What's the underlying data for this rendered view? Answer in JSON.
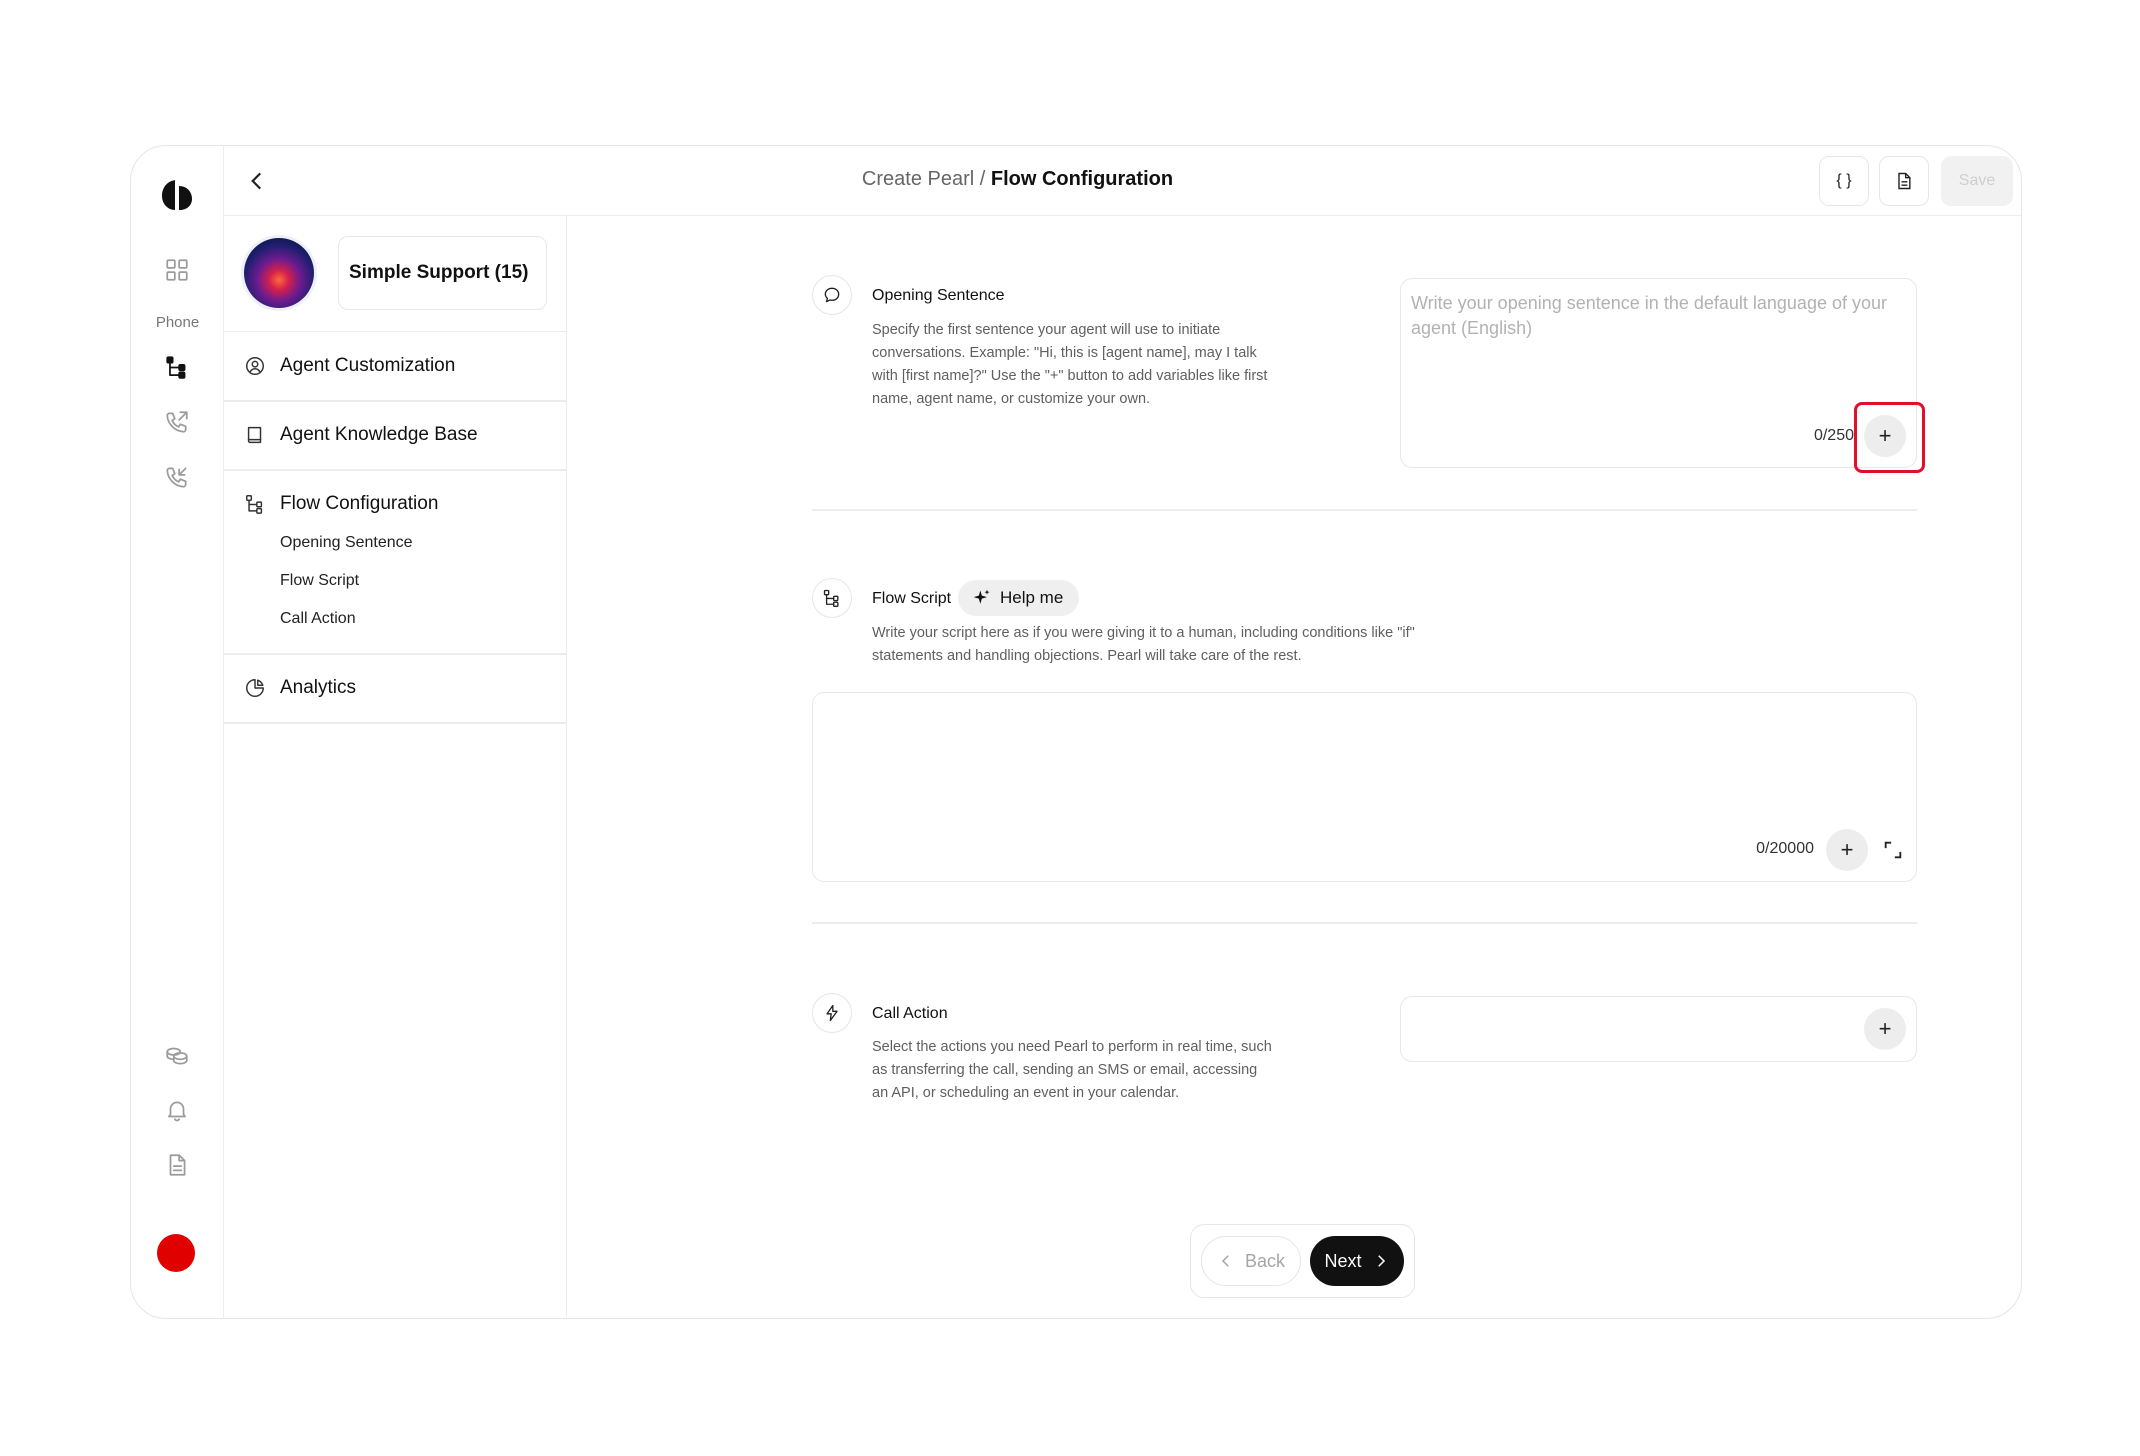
{
  "header": {
    "breadcrumb_parent": "Create Pearl /",
    "breadcrumb_current": "Flow Configuration",
    "variables_label": "{ }",
    "save_label": "Save"
  },
  "rail": {
    "phone_label": "Phone",
    "icons": [
      "logo-icon",
      "grid-icon",
      "flow-icon",
      "outgoing-call-icon",
      "incoming-call-icon",
      "coins-icon",
      "bell-icon",
      "document-icon"
    ],
    "status_color": "#e00000"
  },
  "agent": {
    "name": "Simple Support (15)"
  },
  "nav": {
    "items": [
      {
        "label": "Agent Customization"
      },
      {
        "label": "Agent Knowledge Base"
      },
      {
        "label": "Flow Configuration"
      },
      {
        "label": "Analytics"
      }
    ],
    "sub_items": [
      {
        "label": "Opening Sentence"
      },
      {
        "label": "Flow Script"
      },
      {
        "label": "Call Action"
      }
    ]
  },
  "opening": {
    "title": "Opening Sentence",
    "description": "Specify the first sentence your agent will use to initiate conversations. Example: \"Hi, this is [agent name], may I talk with [first name]?\" Use the \"+\" button to add variables like first name, agent name, or customize your own.",
    "placeholder": "Write your opening sentence in the default language of your agent (English)",
    "counter": "0/250"
  },
  "flow_script": {
    "title": "Flow Script",
    "help_label": "Help me",
    "description": "Write your script here as if you were giving it to a human, including conditions like \"if\" statements and handling objections. Pearl will take care of the rest.",
    "counter": "0/20000"
  },
  "call_action": {
    "title": "Call Action",
    "description": "Select the actions you need Pearl to perform in real time, such as transferring the call, sending an SMS or email, accessing an API, or scheduling an event in your calendar."
  },
  "footer": {
    "back_label": "Back",
    "next_label": "Next"
  },
  "colors": {
    "accent_dark": "#111111",
    "highlight": "#e0102a",
    "status_dot": "#e00000"
  }
}
